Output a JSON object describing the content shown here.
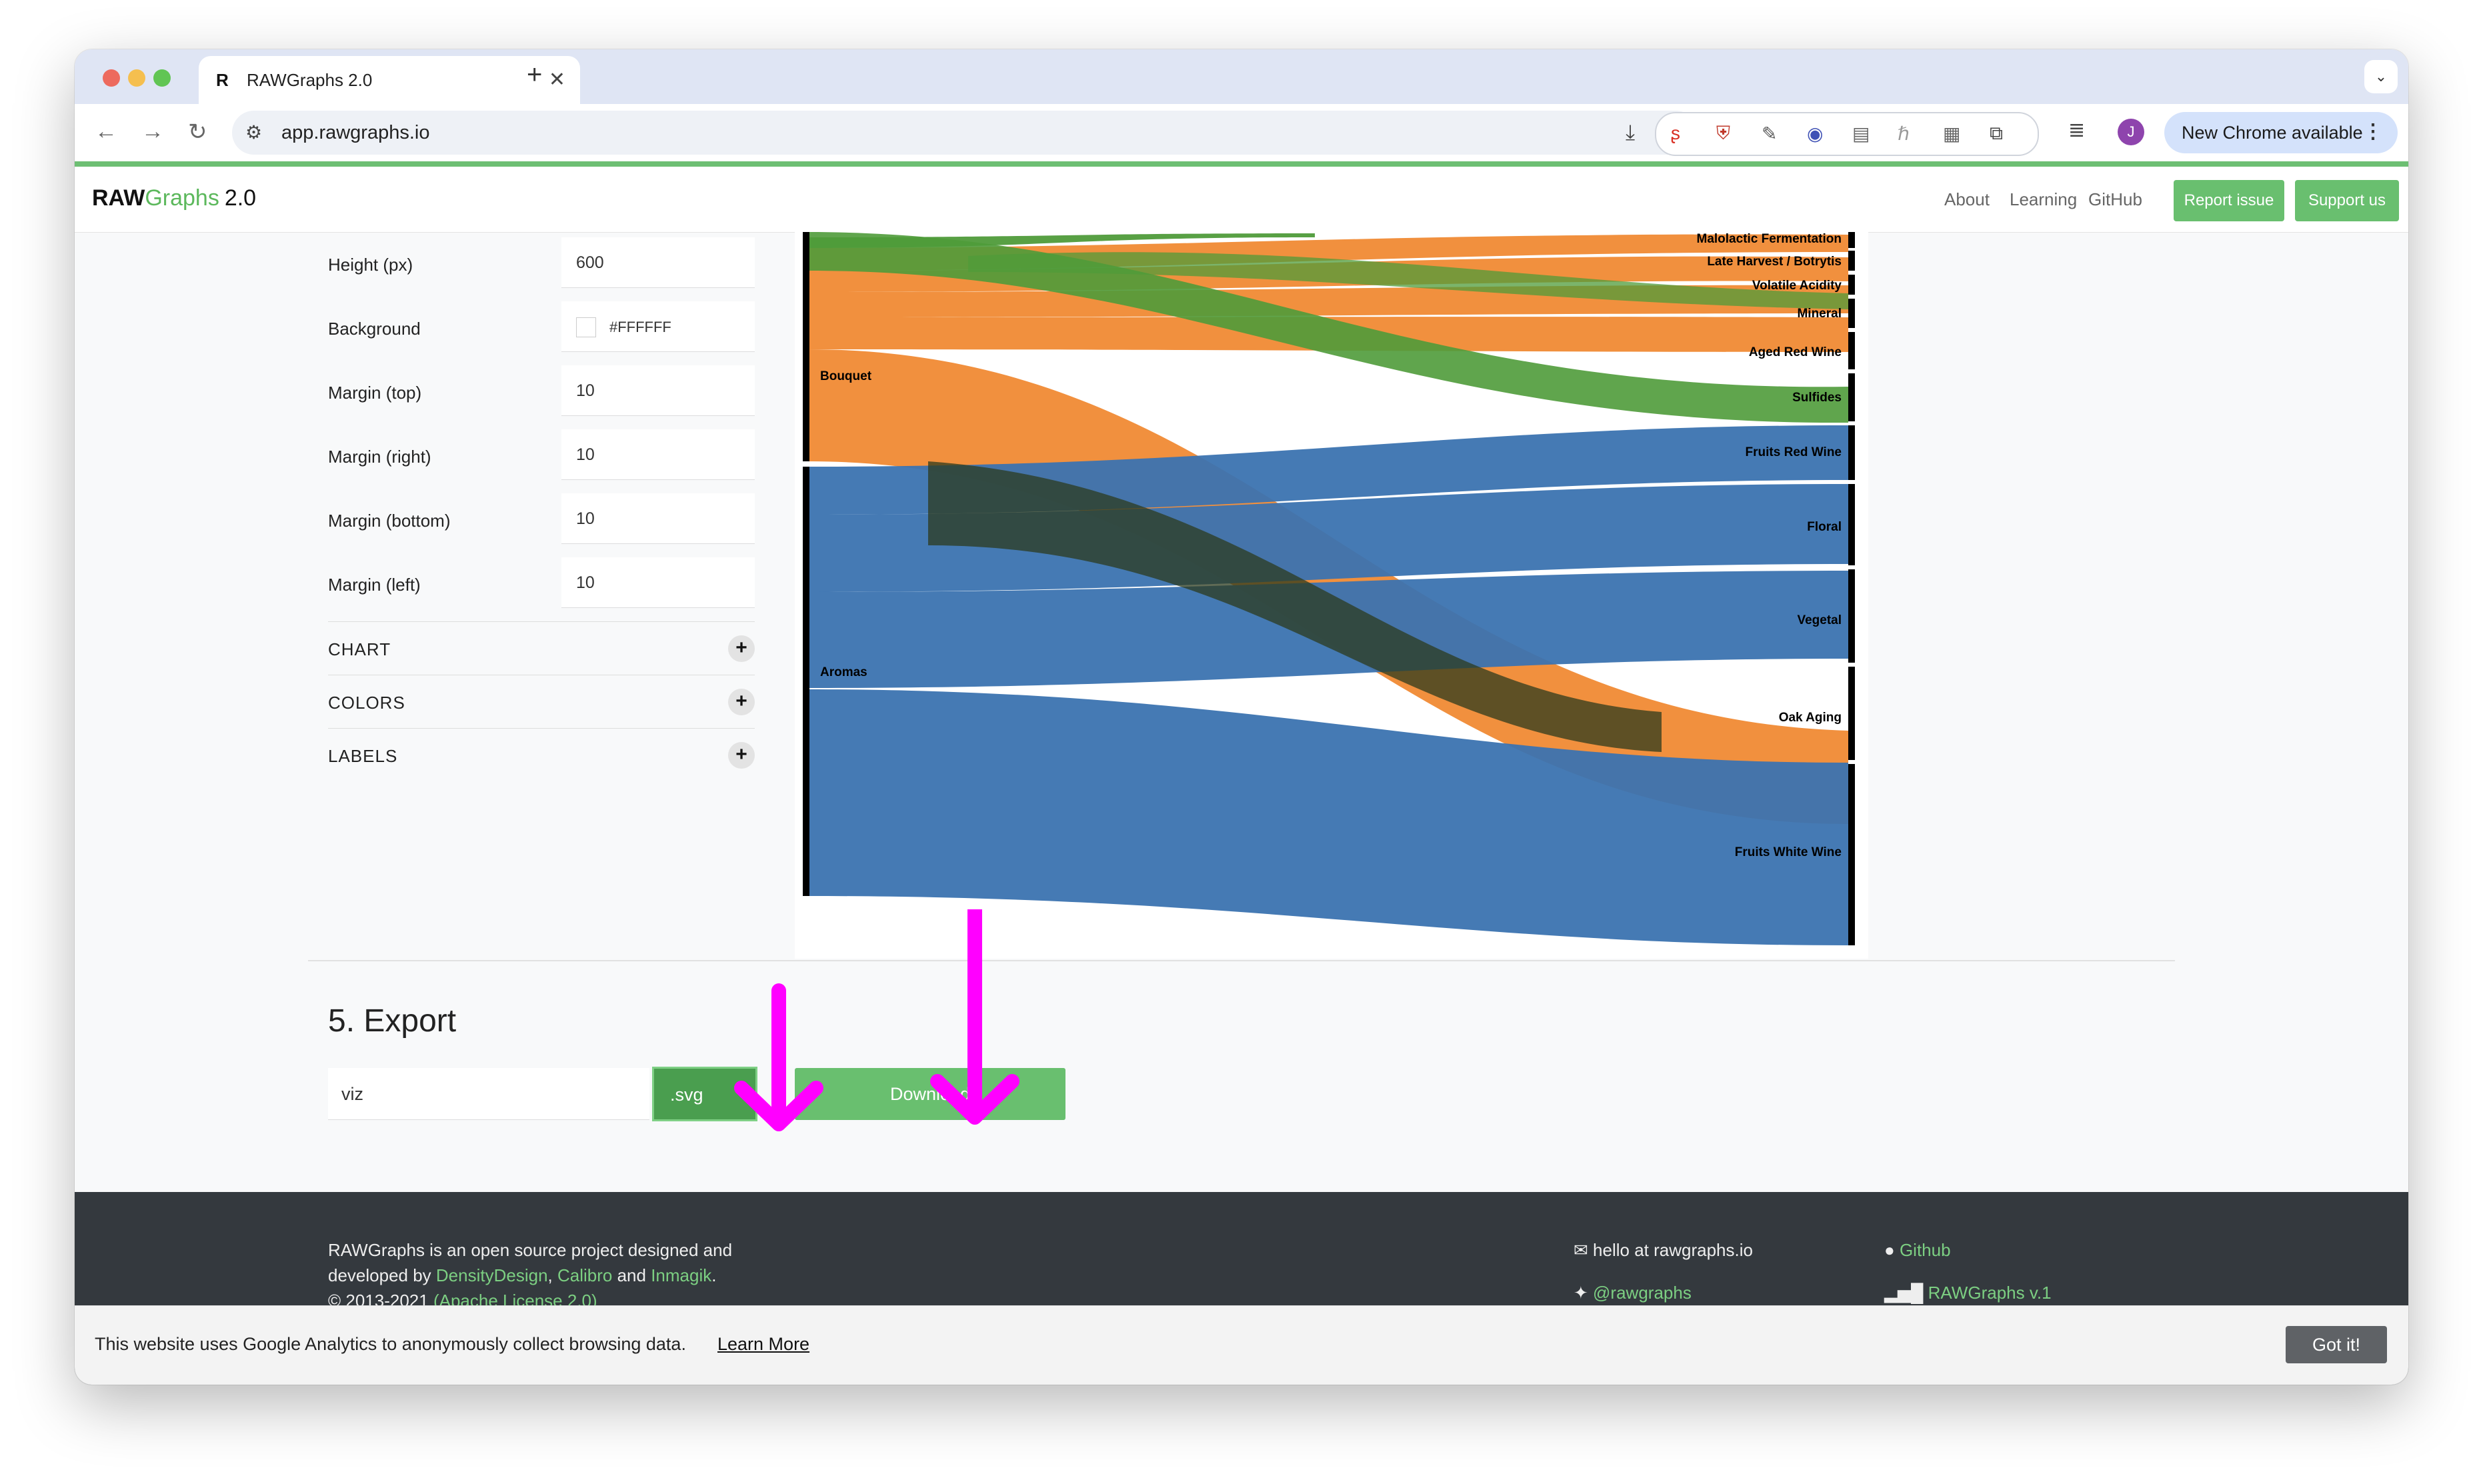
{
  "browser": {
    "tab_title": "RAWGraphs 2.0",
    "favicon": "R",
    "url": "app.rawgraphs.io",
    "avatar_initial": "J",
    "update_label": "New Chrome available"
  },
  "header": {
    "logo_raw": "RAW",
    "logo_graphs": "Graphs",
    "logo_version": "2.0",
    "nav": [
      "About",
      "Learning",
      "GitHub"
    ],
    "report_issue": "Report issue",
    "support_us": "Support us"
  },
  "options": {
    "fields": [
      {
        "label": "Height (px)",
        "value": "600"
      },
      {
        "label": "Background",
        "value": "#FFFFFF"
      },
      {
        "label": "Margin (top)",
        "value": "10"
      },
      {
        "label": "Margin (right)",
        "value": "10"
      },
      {
        "label": "Margin (bottom)",
        "value": "10"
      },
      {
        "label": "Margin (left)",
        "value": "10"
      }
    ],
    "sections": [
      "CHART",
      "COLORS",
      "LABELS"
    ]
  },
  "chart_data": {
    "type": "sankey",
    "sources": [
      "Bouquet",
      "Aromas"
    ],
    "targets": [
      "Malolactic Fermentation",
      "Late Harvest / Botrytis",
      "Volatile Acidity",
      "Mineral",
      "Aged Red Wine",
      "Sulfides",
      "Fruits Red Wine",
      "Floral",
      "Vegetal",
      "Oak Aging",
      "Fruits White Wine"
    ],
    "colors": {
      "green": "#4f9b3a",
      "orange": "#f08a34",
      "blue": "#3b73b0",
      "node": "#000000"
    }
  },
  "export": {
    "title": "5. Export",
    "filename": "viz",
    "format": ".svg",
    "download_label": "Download"
  },
  "footer": {
    "line1": "RAWGraphs is an open source project designed and",
    "line2_prefix": "developed by ",
    "org1": "DensityDesign",
    "sep1": ", ",
    "org2": "Calibro",
    "sep2": " and ",
    "org3": "Inmagik",
    "end": ".",
    "copyright": "© 2013-2021 ",
    "license": "(Apache License 2.0)",
    "email": "hello at rawgraphs.io",
    "twitter": "@rawgraphs",
    "github": "Github",
    "v1": "RAWGraphs v.1"
  },
  "cookie": {
    "text": "This website uses Google Analytics to anonymously collect browsing data.",
    "learn_more": "Learn More",
    "got_it": "Got it!"
  },
  "annotation_color": "#ff00ff"
}
